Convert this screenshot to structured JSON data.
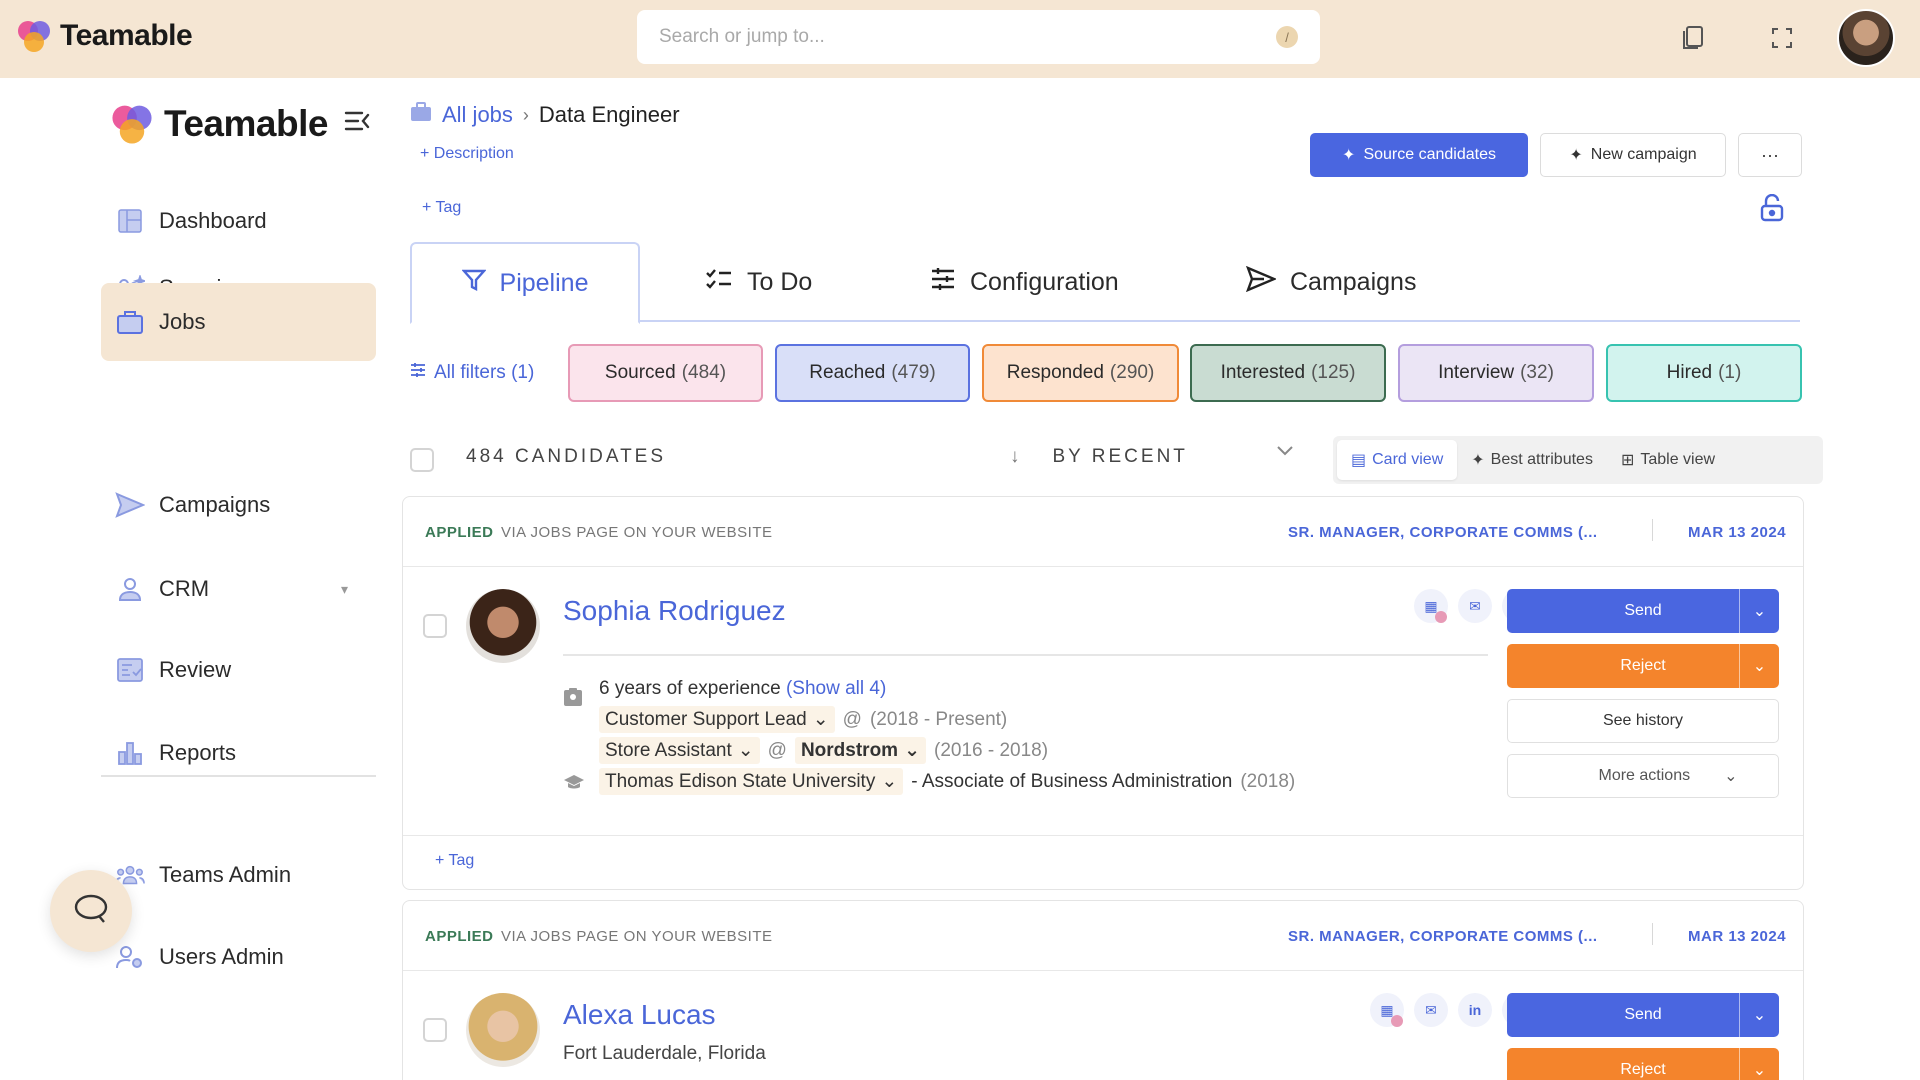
{
  "app": {
    "name": "Teamable"
  },
  "topbar": {
    "search_placeholder": "Search or jump to...",
    "search_shortcut": "/",
    "icons": [
      "copy-icon",
      "fullscreen-icon"
    ]
  },
  "sidebar": {
    "brand": "Teamable",
    "items": [
      {
        "label": "Dashboard",
        "icon": "dashboard-icon"
      },
      {
        "label": "Sourcing",
        "icon": "sourcing-icon"
      },
      {
        "label": "Jobs",
        "icon": "briefcase-icon",
        "active": true
      },
      {
        "label": "Campaigns",
        "icon": "send-icon"
      },
      {
        "label": "CRM",
        "icon": "person-icon"
      },
      {
        "label": "Review",
        "icon": "review-icon"
      },
      {
        "label": "Reports",
        "icon": "bar-chart-icon"
      },
      {
        "label": "Teams Admin",
        "icon": "team-icon"
      },
      {
        "label": "Users Admin",
        "icon": "users-admin-icon"
      }
    ]
  },
  "header": {
    "breadcrumb": {
      "root": "All jobs",
      "current": "Data Engineer"
    },
    "add_description": "+ Description",
    "add_tag": "+ Tag",
    "source_button": "Source candidates",
    "campaign_button": "New campaign",
    "more_button": "···"
  },
  "tabs": [
    {
      "label": "Pipeline",
      "active": true
    },
    {
      "label": "To Do"
    },
    {
      "label": "Configuration"
    },
    {
      "label": "Campaigns"
    }
  ],
  "filters": {
    "label": "All filters (1)"
  },
  "stages": [
    {
      "label": "Sourced",
      "count": "(484)",
      "bg": "#fbe4ec",
      "border": "#e79ab6"
    },
    {
      "label": "Reached",
      "count": "(479)",
      "bg": "#d9dff8",
      "border": "#5b72e0"
    },
    {
      "label": "Responded",
      "count": "(290)",
      "bg": "#fde3cf",
      "border": "#f08a38"
    },
    {
      "label": "Interested",
      "count": "(125)",
      "bg": "#c9dcd2",
      "border": "#3c6b50"
    },
    {
      "label": "Interview",
      "count": "(32)",
      "bg": "#ebe5f5",
      "border": "#b49ede"
    },
    {
      "label": "Hired",
      "count": "(1)",
      "bg": "#d2f3ee",
      "border": "#37c3b0"
    }
  ],
  "list": {
    "count_label": "484 CANDIDATES",
    "sort_label": "BY RECENT",
    "views": [
      {
        "label": "Card view",
        "active": true
      },
      {
        "label": "Best attributes"
      },
      {
        "label": "Table view"
      }
    ]
  },
  "candidates": [
    {
      "status": "APPLIED",
      "via": "VIA JOBS PAGE ON YOUR WEBSITE",
      "role": "SR. MANAGER, CORPORATE COMMS (...",
      "date": "MAR 13 2024",
      "name": "Sophia Rodriguez",
      "experience": "6 years of experience",
      "show_all": "(Show all 4)",
      "jobs": [
        {
          "title": "Customer Support Lead",
          "at": "@",
          "company": "",
          "period": "(2018 - Present)"
        },
        {
          "title": "Store Assistant",
          "at": "@",
          "company": "Nordstrom",
          "period": "(2016 - 2018)"
        }
      ],
      "education": {
        "school": "Thomas Edison State University",
        "degree": "- Associate of Business Administration",
        "year": "(2018)"
      },
      "tag": "+ Tag",
      "actions": {
        "send": "Send",
        "reject": "Reject",
        "history": "See history",
        "more": "More actions"
      }
    },
    {
      "status": "APPLIED",
      "via": "VIA JOBS PAGE ON YOUR WEBSITE",
      "role": "SR. MANAGER, CORPORATE COMMS (...",
      "date": "MAR 13 2024",
      "name": "Alexa Lucas",
      "location": "Fort Lauderdale, Florida",
      "actions": {
        "send": "Send",
        "reject": "Reject"
      }
    }
  ]
}
